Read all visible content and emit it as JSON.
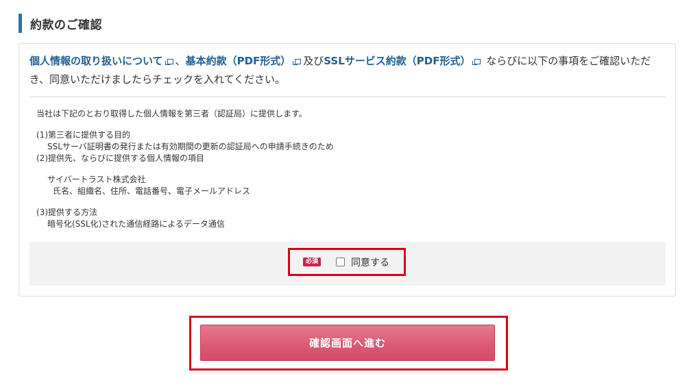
{
  "section": {
    "title": "約款のご確認"
  },
  "intro": {
    "link_privacy": "個人情報の取り扱いについて",
    "sep1": "、",
    "link_basic": "基本約款（PDF形式）",
    "and": "及び",
    "link_ssl": "SSLサービス約款（PDF形式）",
    "rest": "ならびに以下の事項をご確認いただき、同意いただけましたらチェックを入れてください。"
  },
  "terms": {
    "lead": "当社は下記のとおり取得した個人情報を第三者（認証局）に提供します。",
    "item1_title": "(1)第三者に提供する目的",
    "item1_body": "SSLサーバ証明書の発行または有効期間の更新の認証局への申請手続きのため",
    "item2_title": "(2)提供先、ならびに提供する個人情報の項目",
    "item2_company": "サイバートラスト株式会社",
    "item2_fields": "氏名、組織名、住所、電話番号、電子メールアドレス",
    "item3_title": "(3)提供する方法",
    "item3_body": "暗号化(SSL化)された通信経路によるデータ通信"
  },
  "agree": {
    "required_badge": "必須",
    "label": "同意する",
    "checked": false
  },
  "submit": {
    "label": "確認画面へ進む"
  },
  "colors": {
    "accent": "#2e6fa8",
    "link": "#1f5f95",
    "button": "#dc5a74",
    "highlight": "#d7001d",
    "badge": "#c8244b"
  }
}
